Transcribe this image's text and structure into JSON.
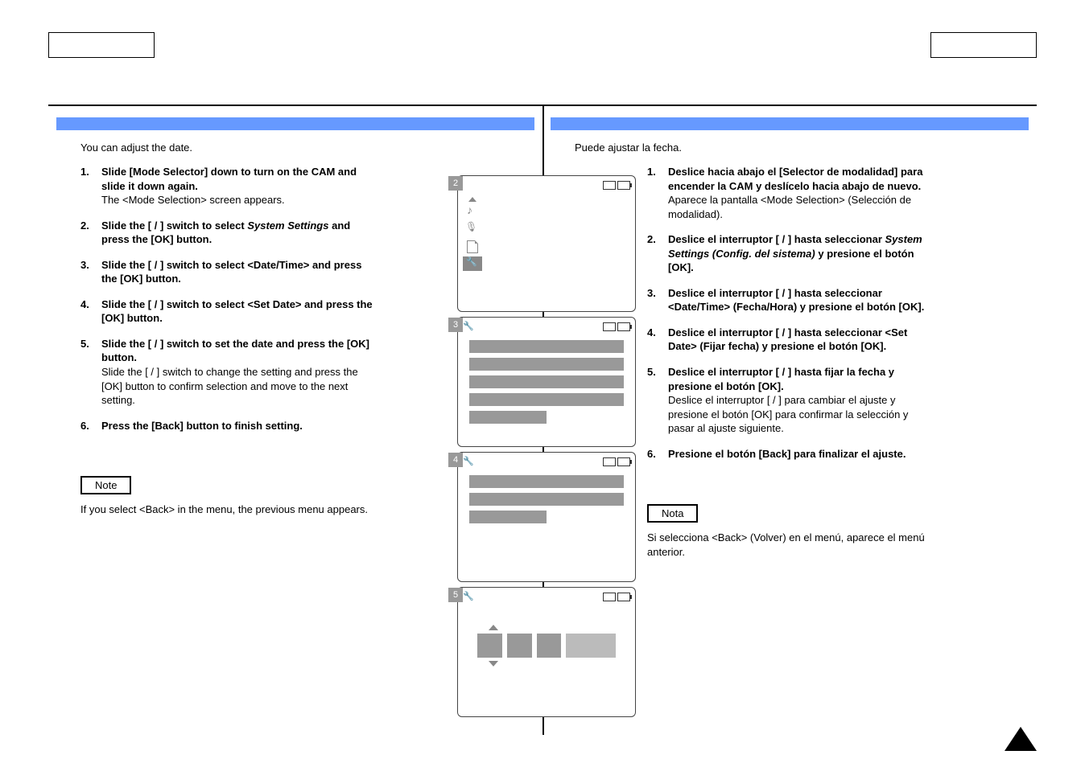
{
  "left": {
    "intro": "You can adjust the date.",
    "steps": [
      {
        "n": "1.",
        "bold": "Slide [Mode Selector] down to turn on the CAM and slide it down again.",
        "sub": "The <Mode Selection> screen appears."
      },
      {
        "n": "2.",
        "pre": "Slide the [   /   ] switch to select ",
        "ital": "System Settings",
        "post": " and press the [OK] button."
      },
      {
        "n": "3.",
        "bold": "Slide the [   /   ] switch to select <Date/Time> and press the [OK] button."
      },
      {
        "n": "4.",
        "bold": "Slide the [   /   ] switch to select <Set Date> and press the [OK] button."
      },
      {
        "n": "5.",
        "bold": "Slide the [   /   ] switch to set the date and press the [OK] button.",
        "sub": "Slide the [   /   ] switch to change the setting and press the [OK] button to confirm selection and move to the next setting."
      },
      {
        "n": "6.",
        "bold": "Press the [Back] button to finish setting."
      }
    ],
    "note_label": "Note",
    "note_text": "If you select <Back> in the menu, the previous menu appears."
  },
  "right": {
    "intro": "Puede ajustar la fecha.",
    "steps": [
      {
        "n": "1.",
        "bold": "Deslice hacia abajo el [Selector de modalidad] para encender la CAM y deslícelo hacia abajo de nuevo.",
        "sub": "Aparece la pantalla <Mode Selection> (Selección de modalidad)."
      },
      {
        "n": "2.",
        "pre": "Deslice el interruptor [   /   ] hasta seleccionar ",
        "ital": "System Settings (Config. del sistema)",
        "post": " y presione el botón [OK]."
      },
      {
        "n": "3.",
        "bold": "Deslice el interruptor [   /   ] hasta seleccionar <Date/Time> (Fecha/Hora) y presione el botón [OK]."
      },
      {
        "n": "4.",
        "bold": "Deslice el interruptor [   /   ] hasta seleccionar <Set Date> (Fijar fecha) y presione el botón [OK]."
      },
      {
        "n": "5.",
        "bold": "Deslice el interruptor [   /   ] hasta fijar la fecha y presione el botón [OK].",
        "sub": "Deslice el interruptor [   /   ] para cambiar el ajuste y presione el botón [OK] para confirmar la selección y pasar al ajuste siguiente."
      },
      {
        "n": "6.",
        "bold": "Presione el botón [Back] para finalizar el ajuste."
      }
    ],
    "note_label": "Nota",
    "note_text": "Si selecciona <Back> (Volver) en el menú, aparece el menú anterior."
  },
  "screens": {
    "n2": "2",
    "n3": "3",
    "n4": "4",
    "n5": "5"
  }
}
